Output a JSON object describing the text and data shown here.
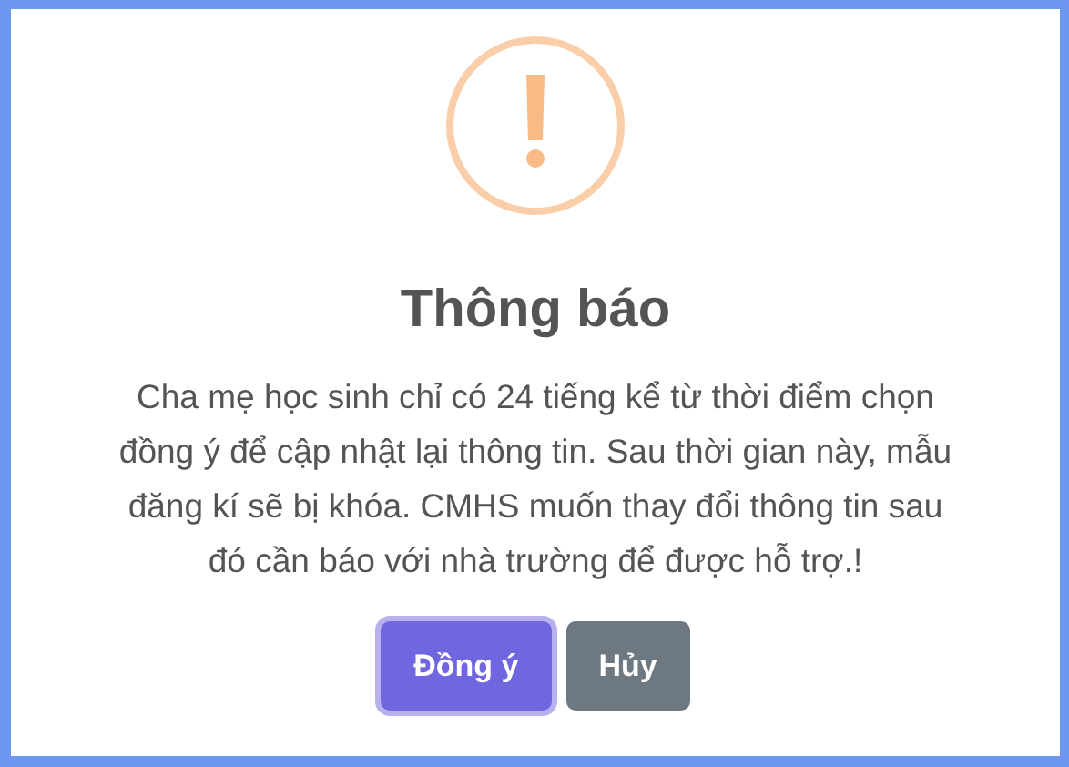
{
  "dialog": {
    "title": "Thông báo",
    "message": "Cha mẹ học sinh chỉ có 24 tiếng kể từ thời điểm chọn đồng ý để cập nhật lại thông tin. Sau thời gian này, mẫu đăng kí sẽ bị khóa. CMHS muốn thay đổi thông tin sau đó cần báo với nhà trường để được hỗ trợ.!",
    "buttons": [
      {
        "kind": "confirm",
        "label": "Đồng ý",
        "focused": true
      },
      {
        "kind": "cancel",
        "label": "Hủy",
        "focused": false
      }
    ]
  }
}
